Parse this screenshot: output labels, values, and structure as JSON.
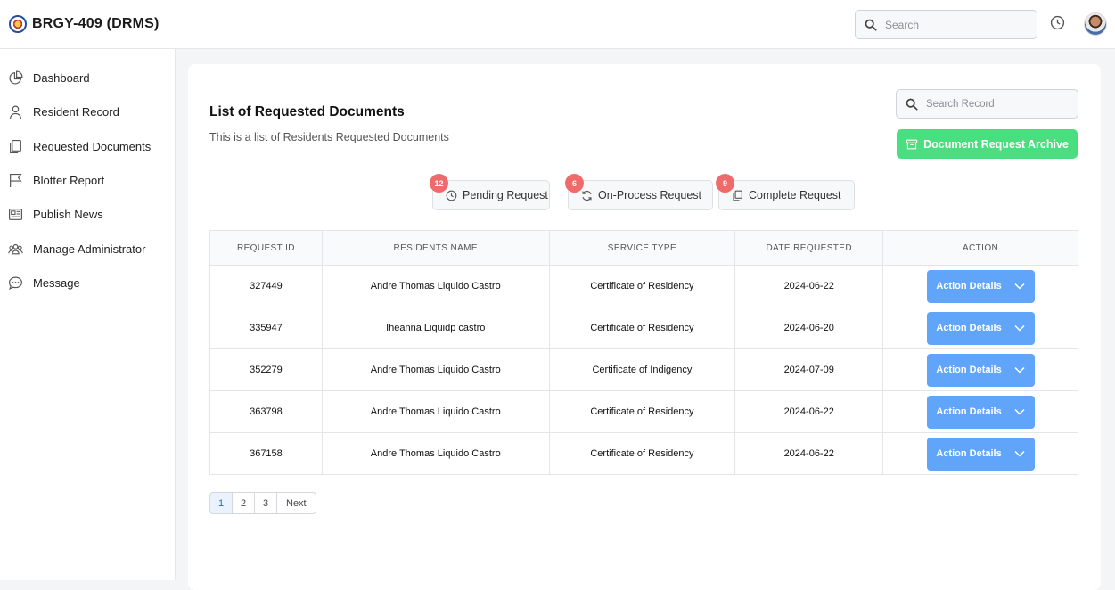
{
  "app": {
    "title": "BRGY-409 (DRMS)"
  },
  "header": {
    "search_placeholder": "Search"
  },
  "sidebar": {
    "items": [
      {
        "label": "Dashboard",
        "icon": "pie-chart-icon"
      },
      {
        "label": "Resident Record",
        "icon": "user-icon"
      },
      {
        "label": "Requested Documents",
        "icon": "documents-icon"
      },
      {
        "label": "Blotter Report",
        "icon": "flag-icon"
      },
      {
        "label": "Publish News",
        "icon": "newspaper-icon"
      },
      {
        "label": "Manage Administrator",
        "icon": "users-icon"
      },
      {
        "label": "Message",
        "icon": "chat-icon"
      }
    ]
  },
  "main": {
    "title": "List of Requested Documents",
    "subtitle": "This is a list of Residents Requested Documents",
    "search_placeholder": "Search Record",
    "archive_label": "Document Request Archive",
    "status_tabs": [
      {
        "label": "Pending Request",
        "count": "12",
        "icon": "clock-icon"
      },
      {
        "label": "On-Process Request",
        "count": "6",
        "icon": "refresh-icon"
      },
      {
        "label": "Complete Request",
        "count": "9",
        "icon": "copy-icon"
      }
    ],
    "table": {
      "headers": [
        "REQUEST ID",
        "RESIDENTS NAME",
        "SERVICE TYPE",
        "DATE REQUESTED",
        "ACTION"
      ],
      "rows": [
        {
          "id": "327449",
          "name": "Andre Thomas Liquido Castro",
          "service": "Certificate of Residency",
          "date": "2024-06-22",
          "action": "Action Details"
        },
        {
          "id": "335947",
          "name": "Iheanna Liquidp castro",
          "service": "Certificate of Residency",
          "date": "2024-06-20",
          "action": "Action Details"
        },
        {
          "id": "352279",
          "name": "Andre Thomas Liquido Castro",
          "service": "Certificate of Indigency",
          "date": "2024-07-09",
          "action": "Action Details"
        },
        {
          "id": "363798",
          "name": "Andre Thomas Liquido Castro",
          "service": "Certificate of Residency",
          "date": "2024-06-22",
          "action": "Action Details"
        },
        {
          "id": "367158",
          "name": "Andre Thomas Liquido Castro",
          "service": "Certificate of Residency",
          "date": "2024-06-22",
          "action": "Action Details"
        }
      ]
    },
    "pagination": {
      "pages": [
        "1",
        "2",
        "3"
      ],
      "next": "Next"
    }
  },
  "colors": {
    "accent_blue": "#60a5fa",
    "archive_green": "#4ade80",
    "badge_red": "#ef6b6b"
  }
}
